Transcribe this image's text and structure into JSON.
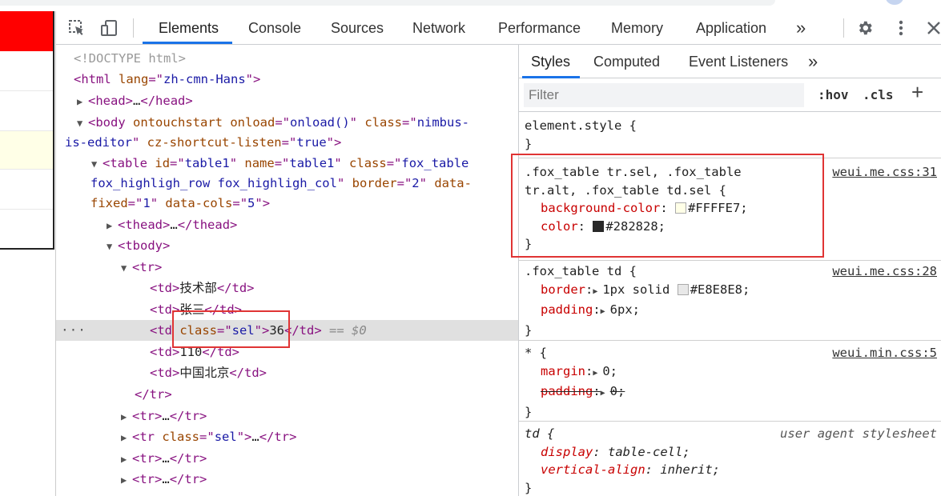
{
  "toolbar": {
    "tabs": [
      "Elements",
      "Console",
      "Sources",
      "Network",
      "Performance",
      "Memory",
      "Application"
    ],
    "overflow": "»"
  },
  "dom": {
    "doctype": "<!DOCTYPE html>",
    "html_tag": "html",
    "html_attr": "lang",
    "html_attr_val": "zh-cmn-Hans",
    "head": "head",
    "body_tag": "body",
    "body_attr1": "ontouchstart",
    "body_attr2": "onload",
    "body_attr2_val": "onload()",
    "body_attr3": "class",
    "body_attr3_val_a": "nimbus-",
    "body_attr3_val_b": "is-editor",
    "body_attr4": "cz-shortcut-listen",
    "body_attr4_val": "true",
    "table_line1_a": "table",
    "table_id": "id",
    "table_id_val": "table1",
    "table_name": "name",
    "table_name_val": "table1",
    "table_class": "class",
    "table_class_val_a": "fox_table",
    "table_class_val_b": "fox_highligh_row fox_highligh_col",
    "table_border": "border",
    "table_border_val": "2",
    "table_data": "data-",
    "table_data_b": "fixed",
    "table_data_val": "1",
    "table_cols": "data-cols",
    "table_cols_val": "5",
    "thead": "thead",
    "tbody": "tbody",
    "tr": "tr",
    "td1": "技术部",
    "td2": "张三",
    "td3_attr": "class",
    "td3_attr_val": "sel",
    "td3": "36",
    "td3_suffix": "== $0",
    "td4": "110",
    "td5": "中国北京",
    "tr_sel_attr": "class",
    "tr_sel_val": "sel"
  },
  "styles": {
    "tabs": [
      "Styles",
      "Computed",
      "Event Listeners"
    ],
    "overflow": "»",
    "filter_placeholder": "Filter",
    "hov": ":hov",
    "cls": ".cls",
    "plus": "+",
    "rules": {
      "element_style": "element.style {",
      "close": "}",
      "r1_sel_a": ".fox_table tr.sel, .fox_table",
      "r1_sel_b": "tr.alt, .fox_table td.sel {",
      "r1_src": "weui.me.css:31",
      "r1_p1": "background-color",
      "r1_v1": "#FFFFE7;",
      "r1_c1": "#FFFFE7",
      "r1_p2": "color",
      "r1_v2": "#282828;",
      "r1_c2": "#282828",
      "r2_sel": ".fox_table td {",
      "r2_src": "weui.me.css:28",
      "r2_p1": "border",
      "r2_v1a": "1px solid",
      "r2_v1b": "#E8E8E8;",
      "r2_c1": "#E8E8E8",
      "r2_p2": "padding",
      "r2_v2": "6px;",
      "r3_sel": "* {",
      "r3_src": "weui.min.css:5",
      "r3_p1": "margin",
      "r3_v1": "0;",
      "r3_p2": "padding",
      "r3_v2": "0;",
      "r4_sel": "td {",
      "r4_src": "user agent stylesheet",
      "r4_p1": "display",
      "r4_v1": "table-cell;",
      "r4_p2": "vertical-align",
      "r4_v2": "inherit;"
    }
  },
  "colors": {
    "accent": "#1a73e8",
    "highlight_box": "#e03434",
    "page_red": "#ff0000",
    "page_yellow": "#ffffe7"
  }
}
